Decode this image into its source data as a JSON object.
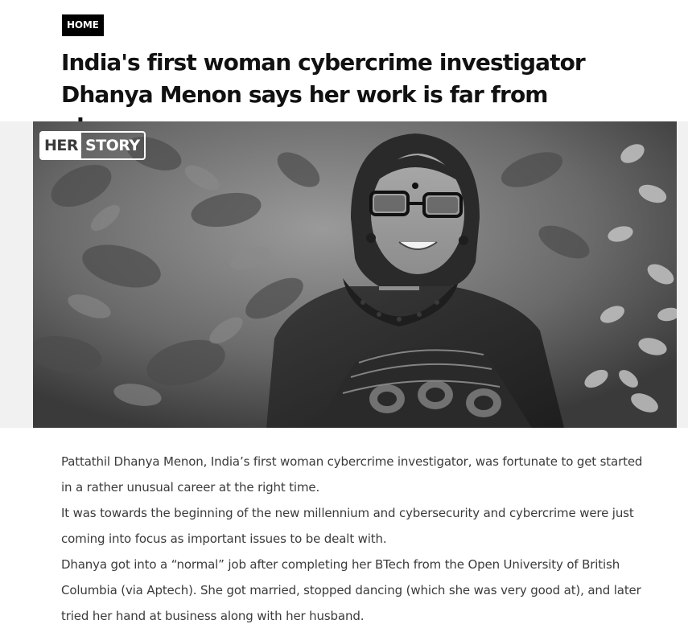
{
  "breadcrumb": {
    "label": "HOME"
  },
  "article": {
    "title": "India's first woman cybercrime investigator Dhanya Menon says her work is far from glamorous",
    "image": {
      "logo_part1": "HER",
      "logo_part2": "STORY",
      "style": "black-and-white portrait photo"
    },
    "paragraphs": [
      "Pattathil Dhanya Menon, India’s first woman cybercrime investigator, was fortunate to get started in a rather unusual career at the right time.",
      "It was towards the beginning of the new millennium and cybersecurity and cybercrime were just coming into focus as important issues to be dealt with.",
      "Dhanya got into a “normal” job after completing her BTech from the Open University of British Columbia (via Aptech). She got married, stopped dancing (which she was very good at), and later tried her hand at business along with her husband."
    ]
  },
  "colors": {
    "badge_background": "#000000",
    "title_text": "#111111",
    "body_text": "#3b3b3b"
  }
}
